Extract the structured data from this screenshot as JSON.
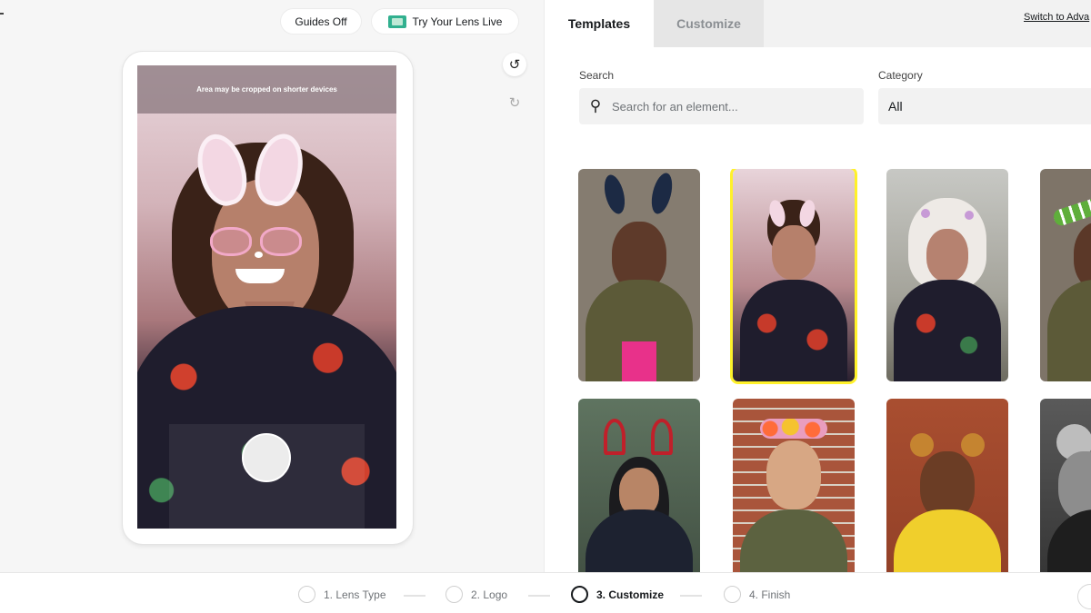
{
  "toolbar": {
    "guides_label": "Guides Off",
    "lens_live_label": "Try Your Lens Live",
    "lens_live_icon": "lens-preview-icon",
    "undo_icon": "undo-icon",
    "redo_icon": "redo-icon"
  },
  "preview": {
    "crop_notice": "Area may be cropped on shorter devices"
  },
  "tabs": [
    {
      "label": "Templates",
      "active": true
    },
    {
      "label": "Customize",
      "active": false
    }
  ],
  "switch_link": "Switch to Adva",
  "search": {
    "label": "Search",
    "placeholder": "Search for an element...",
    "value": ""
  },
  "category": {
    "label": "Category",
    "value": "All"
  },
  "colors": {
    "selected_outline": "#fff12a",
    "accent_green": "#31b08f",
    "active_tab_bg": "#ffffff",
    "inactive_tab_bg": "#e6e6e6"
  },
  "steps": [
    {
      "label": "1. Lens Type",
      "active": false
    },
    {
      "label": "2. Logo",
      "active": false
    },
    {
      "label": "3. Customize",
      "active": true
    },
    {
      "label": "4. Finish",
      "active": false
    }
  ]
}
